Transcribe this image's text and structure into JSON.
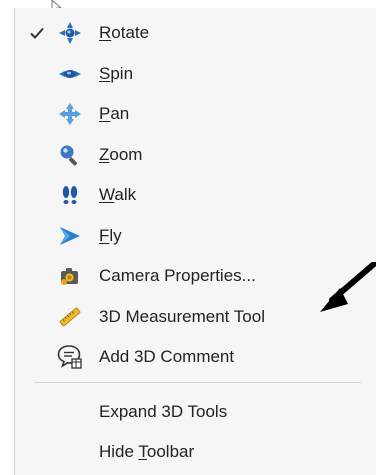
{
  "menu": {
    "items": [
      {
        "pre": "",
        "u": "R",
        "post": "otate",
        "checked": true,
        "icon": "rotate-icon"
      },
      {
        "pre": "",
        "u": "S",
        "post": "pin",
        "checked": false,
        "icon": "spin-icon"
      },
      {
        "pre": "",
        "u": "P",
        "post": "an",
        "checked": false,
        "icon": "pan-icon"
      },
      {
        "pre": "",
        "u": "Z",
        "post": "oom",
        "checked": false,
        "icon": "zoom-icon"
      },
      {
        "pre": "",
        "u": "W",
        "post": "alk",
        "checked": false,
        "icon": "walk-icon"
      },
      {
        "pre": "",
        "u": "F",
        "post": "ly",
        "checked": false,
        "icon": "fly-icon"
      },
      {
        "pre": "Camera Properties...",
        "u": "",
        "post": "",
        "checked": false,
        "icon": "camera-properties-icon"
      },
      {
        "pre": "3D Measurement Tool",
        "u": "",
        "post": "",
        "checked": false,
        "icon": "ruler-icon"
      },
      {
        "pre": "Add 3D Comment",
        "u": "",
        "post": "",
        "checked": false,
        "icon": "comment-icon"
      },
      {
        "pre": "Expand 3D Tools",
        "u": "",
        "post": "",
        "checked": false,
        "icon": ""
      },
      {
        "pre": "Hide ",
        "u": "T",
        "post": "oolbar",
        "checked": false,
        "icon": ""
      }
    ]
  },
  "colors": {
    "menu_bg": "#f6f6f6",
    "icon_blue": "#2a6fc0",
    "text": "#222222",
    "annotation_arrow": "#000000"
  }
}
